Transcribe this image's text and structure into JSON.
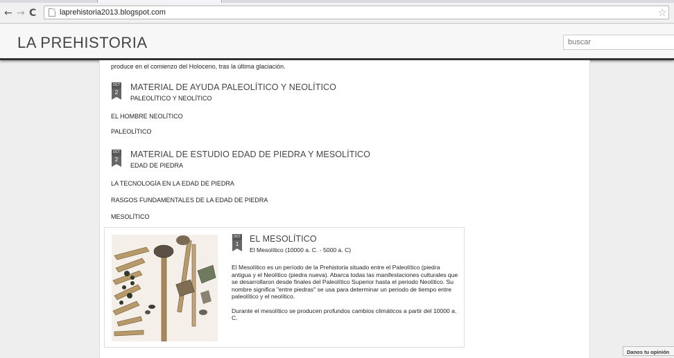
{
  "browser": {
    "url": "laprehistoria2013.blogspot.com",
    "back_icon": "←",
    "forward_icon": "→",
    "reload_icon": "C",
    "star_icon": "☆"
  },
  "blog": {
    "title": "LA PREHISTORIA",
    "search_placeholder": "buscar"
  },
  "content": {
    "intro_text": "produce en el comienzo del Holoceno, tras la última glaciación.",
    "posts": [
      {
        "month": "OCT",
        "day": "2",
        "title": "MATERIAL DE AYUDA PALEOLÍTICO Y NEOLÍTICO",
        "subtitle": "PALEOLÍTICO Y NEOLÍTICO",
        "links": [
          "EL HOMBRE NEOLÍTICO",
          "PALEOLÍTICO"
        ]
      },
      {
        "month": "OCT",
        "day": "2",
        "title": "MATERIAL DE ESTUDIO EDAD DE PIEDRA Y MESOLÍTICO",
        "subtitle": "EDAD DE PIEDRA",
        "links": [
          "LA TECNOLOGÍA EN LA EDAD DE PIEDRA",
          "RASGOS FUNDAMENTALES DE LA EDAD DE PIEDRA",
          "MESOLÍTICO"
        ]
      }
    ],
    "featured": {
      "month": "OCT",
      "day": "1",
      "title": "EL MESOLÍTICO",
      "subtitle": "El Mesolítico (10000 a. C. - 5000 a. C)",
      "paragraph1": "El Mesolítico es un período de la Prehistoria situado entre el Paleolítico (piedra antigua y el Neolítico (piedra nueva). Abarca todas las manifestaciones culturales que se desarrollaron desde finales del Paleolítico Superior hasta el periodo Neolítico. Su nombre significa \"entre piedras\" se usa para determinar un periodo de tiempo entre paleolítico y el neolítico.",
      "paragraph2": "Durante el mesolítico se producen profundos cambios climáticos a partir del 10000 a. C."
    }
  },
  "feedback": {
    "label": "Danos tu opinión"
  }
}
